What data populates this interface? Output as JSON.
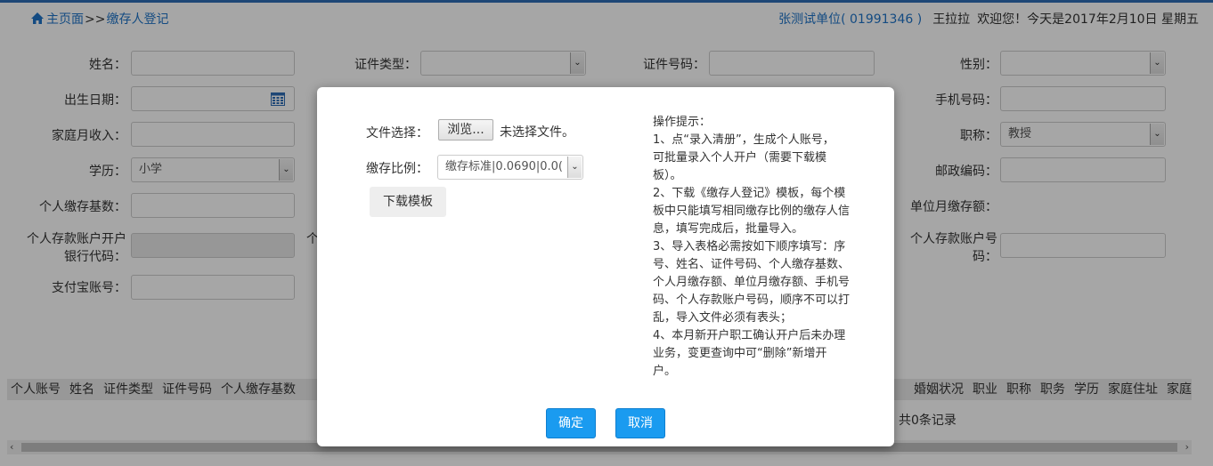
{
  "header": {
    "home_label": "主页面",
    "separator": ">>",
    "current": "缴存人登记",
    "unit": "张测试单位( 01991346 )",
    "user": "王拉拉",
    "greeting": "欢迎您！今天是2017年2月10日 星期五"
  },
  "form": {
    "name_label": "姓名：",
    "id_type_label": "证件类型：",
    "id_no_label": "证件号码：",
    "gender_label": "性别：",
    "birth_label": "出生日期：",
    "mobile_label": "手机号码：",
    "family_income_label": "家庭月收入：",
    "title_label": "职称：",
    "title_value": "教授",
    "education_label": "学历：",
    "education_value": "小学",
    "postcode_label": "邮政编码：",
    "base_label": "个人缴存基数：",
    "unit_monthly_label": "单位月缴存额：",
    "bank_code_label": "个人存款账户开户银行代码：",
    "bank_code_label_l1": "个人存款账户开户",
    "bank_code_label_l2": "银行代码：",
    "account_label_l1": "个人存款账户号",
    "account_label_l2": "码：",
    "hidden_label_fragment": "个",
    "alipay_label": "支付宝账号："
  },
  "grid": {
    "columns_left": [
      "个人账号",
      "姓名",
      "证件类型",
      "证件号码",
      "个人缴存基数"
    ],
    "columns_right": [
      "婚姻状况",
      "职业",
      "职称",
      "职务",
      "学历",
      "家庭住址",
      "家庭"
    ],
    "records": "共0条记录"
  },
  "modal": {
    "file_label": "文件选择：",
    "browse": "浏览...",
    "no_file": "未选择文件。",
    "ratio_label": "缴存比例：",
    "ratio_value": "缴存标准|0.0690|0.0(",
    "download": "下载模板",
    "tips": [
      "操作提示：",
      "1、点“录入清册”，生成个人账号，",
      "可批量录入个人开户（需要下载模",
      "板）。",
      "2、下载《缴存人登记》模板，每个模",
      "板中只能填写相同缴存比例的缴存人信",
      "息，填写完成后，批量导入。",
      "3、导入表格必需按如下顺序填写：序",
      "号、姓名、证件号码、个人缴存基数、",
      "个人月缴存额、单位月缴存额、手机号",
      "码、个人存款账户号码，顺序不可以打",
      "乱，导入文件必须有表头；",
      "4、本月新开户职工确认开户后未办理",
      "业务，变更查询中可“删除”新增开",
      "户。"
    ],
    "ok": "确定",
    "cancel": "取消"
  },
  "colors": {
    "link": "#1f74c8",
    "primary_button": "#1a9bf0"
  },
  "icons": [
    "home-icon",
    "calendar-icon",
    "chevron-down-icon"
  ]
}
